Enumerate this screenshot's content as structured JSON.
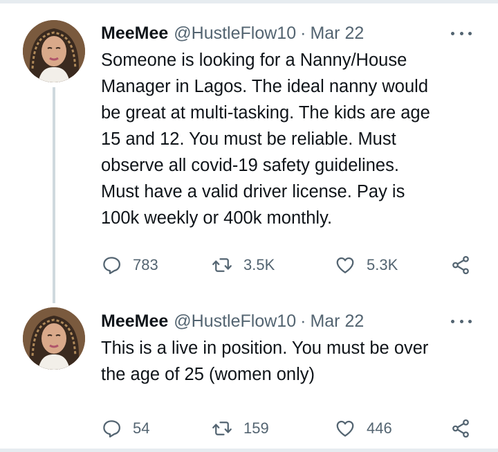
{
  "tweets": [
    {
      "display_name": "MeeMee",
      "handle": "@HustleFlow10",
      "separator": "·",
      "date": "Mar 22",
      "text": "Someone is looking for a Nanny/House\nManager in Lagos. The ideal nanny would\nbe great at multi-tasking. The kids are age\n15 and 12. You must be reliable. Must\nobserve all covid-19 safety guidelines.\nMust have a valid driver license. Pay is\n100k weekly or 400k monthly.",
      "replies": "783",
      "retweets": "3.5K",
      "likes": "5.3K"
    },
    {
      "display_name": "MeeMee",
      "handle": "@HustleFlow10",
      "separator": "·",
      "date": "Mar 22",
      "text": "This is a live in position. You must be over\nthe age of 25 (women only)",
      "replies": "54",
      "retweets": "159",
      "likes": "446"
    }
  ],
  "icons": {
    "reply": "reply-icon",
    "retweet": "retweet-icon",
    "like": "heart-icon",
    "share": "share-icon",
    "more": "more-options-icon"
  },
  "colors": {
    "text_primary": "#0f1419",
    "text_secondary": "#536471",
    "thread_line": "#cfd9de",
    "divider": "#e6ecf0"
  }
}
